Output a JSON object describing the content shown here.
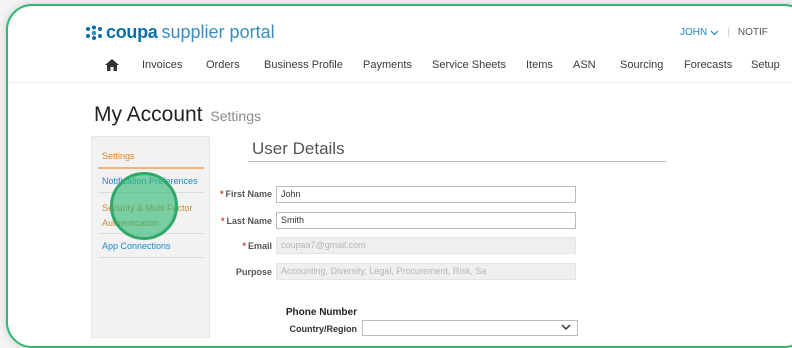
{
  "brand": {
    "name_bold": "coupa",
    "name_rest": "supplier portal",
    "color": "#0a6ea8"
  },
  "user": {
    "name": "JOHN",
    "notifications": "NOTIF"
  },
  "nav": {
    "items": [
      "Invoices",
      "Orders",
      "Business Profile",
      "Payments",
      "Service Sheets",
      "Items",
      "ASN",
      "Sourcing",
      "Forecasts",
      "Setup"
    ]
  },
  "page": {
    "title": "My Account",
    "subtitle": "Settings"
  },
  "sidebar": {
    "items": [
      {
        "label": "Settings"
      },
      {
        "label": "Notification Preferences"
      },
      {
        "label": "Security & Multi Factor Authentication"
      },
      {
        "label": "App Connections"
      }
    ]
  },
  "user_details": {
    "title": "User Details",
    "first_name": {
      "label": "First Name",
      "value": "John"
    },
    "last_name": {
      "label": "Last Name",
      "value": "Smith"
    },
    "email": {
      "label": "Email",
      "value": "coupaa7@gmail.com"
    },
    "purpose": {
      "label": "Purpose",
      "value": "Accounting, Diversity, Legal, Procurement, Risk, Sa"
    }
  },
  "phone": {
    "header": "Phone Number",
    "country_label": "Country/Region",
    "country_value": ""
  },
  "colors": {
    "accent_green": "#2eb872",
    "link_blue": "#1e88c9",
    "active_orange": "#e07e22",
    "required_red": "#d9342b"
  }
}
